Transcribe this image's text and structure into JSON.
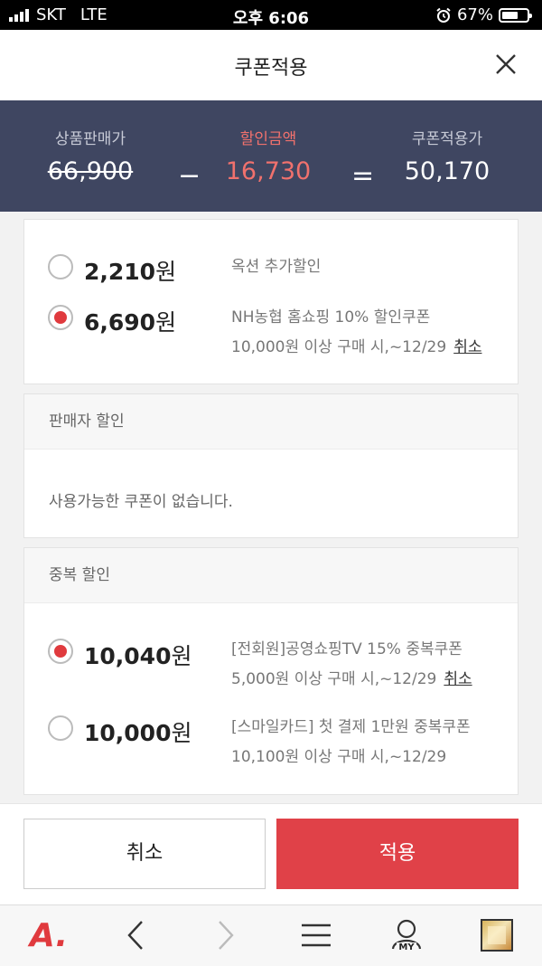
{
  "status_bar": {
    "carrier": "SKT",
    "network": "LTE",
    "time": "오후 6:06",
    "battery": "67%",
    "battery_level": 0.67
  },
  "header": {
    "title": "쿠폰적용"
  },
  "summary": {
    "original_label": "상품판매가",
    "original_value": "66,900",
    "minus": "−",
    "discount_label": "할인금액",
    "discount_value": "16,730",
    "equals": "=",
    "final_label": "쿠폰적용가",
    "final_value": "50,170"
  },
  "coupon_options": [
    {
      "amount": "2,210",
      "unit": "원",
      "selected": false,
      "line1": "옥션 추가할인",
      "line2": "",
      "action": ""
    },
    {
      "amount": "6,690",
      "unit": "원",
      "selected": true,
      "line1": "NH농협 홈쇼핑 10% 할인쿠폰",
      "line2": "10,000원 이상 구매 시,~12/29",
      "action": "취소"
    }
  ],
  "seller_section": {
    "title": "판매자 할인",
    "empty_text": "사용가능한 쿠폰이 없습니다."
  },
  "duplicate_section": {
    "title": "중복 할인",
    "options": [
      {
        "amount": "10,040",
        "unit": "원",
        "selected": true,
        "line1": "[전회원]공영쇼핑TV 15% 중복쿠폰",
        "line2": "5,000원 이상 구매 시,~12/29",
        "action": "취소"
      },
      {
        "amount": "10,000",
        "unit": "원",
        "selected": false,
        "line1": "[스마일카드] 첫 결제 1만원 중복쿠폰",
        "line2": "10,100원 이상 구매 시,~12/29",
        "action": ""
      }
    ]
  },
  "buttons": {
    "cancel": "취소",
    "apply": "적용"
  },
  "toolbar": {
    "logo": "A.",
    "my_label": "MY"
  },
  "colors": {
    "accent": "#e03a3e",
    "summary_bg": "#3f4661",
    "discount_text": "#f0716d"
  }
}
